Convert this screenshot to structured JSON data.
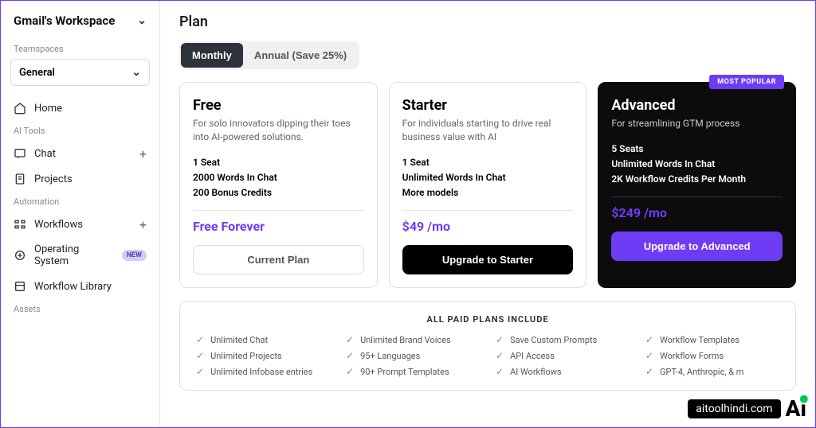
{
  "sidebar": {
    "workspace": "Gmail's Workspace",
    "sections": {
      "teamspaces": {
        "label": "Teamspaces",
        "general": "General"
      },
      "home": "Home",
      "ai_tools": {
        "label": "AI Tools",
        "chat": "Chat",
        "projects": "Projects"
      },
      "automation": {
        "label": "Automation",
        "workflows": "Workflows",
        "os": "Operating System",
        "os_badge": "NEW",
        "library": "Workflow Library"
      },
      "assets": {
        "label": "Assets"
      }
    }
  },
  "page_title": "Plan",
  "toggle": {
    "monthly": "Monthly",
    "annual": "Annual (Save 25%)"
  },
  "plans": {
    "free": {
      "name": "Free",
      "desc": "For solo innovators dipping their toes into AI-powered solutions.",
      "f1": "1 Seat",
      "f2": "2000 Words In Chat",
      "f3": "200 Bonus Credits",
      "price": "Free Forever",
      "cta": "Current Plan"
    },
    "starter": {
      "name": "Starter",
      "desc": "For individuals starting to drive real business value with AI",
      "f1": "1 Seat",
      "f2": "Unlimited Words In Chat",
      "f3": "More models",
      "price": "$49 /mo",
      "cta": "Upgrade to Starter"
    },
    "advanced": {
      "badge": "MOST POPULAR",
      "name": "Advanced",
      "desc": "For streamlining GTM process",
      "f1": "5 Seats",
      "f2": "Unlimited Words In Chat",
      "f3": "2K Workflow Credits Per Month",
      "price": "$249 /mo",
      "cta": "Upgrade to Advanced"
    }
  },
  "features": {
    "title": "ALL PAID PLANS INCLUDE",
    "items": [
      "Unlimited Chat",
      "Unlimited Brand Voices",
      "Save Custom Prompts",
      "Workflow Templates",
      "Unlimited Projects",
      "95+ Languages",
      "API Access",
      "Workflow Forms",
      "Unlimited Infobase entries",
      "90+ Prompt Templates",
      "AI Workflows",
      "GPT-4, Anthropic, & m"
    ]
  },
  "watermark": {
    "text": "aitoolhindi.com",
    "logo": "Ai"
  }
}
